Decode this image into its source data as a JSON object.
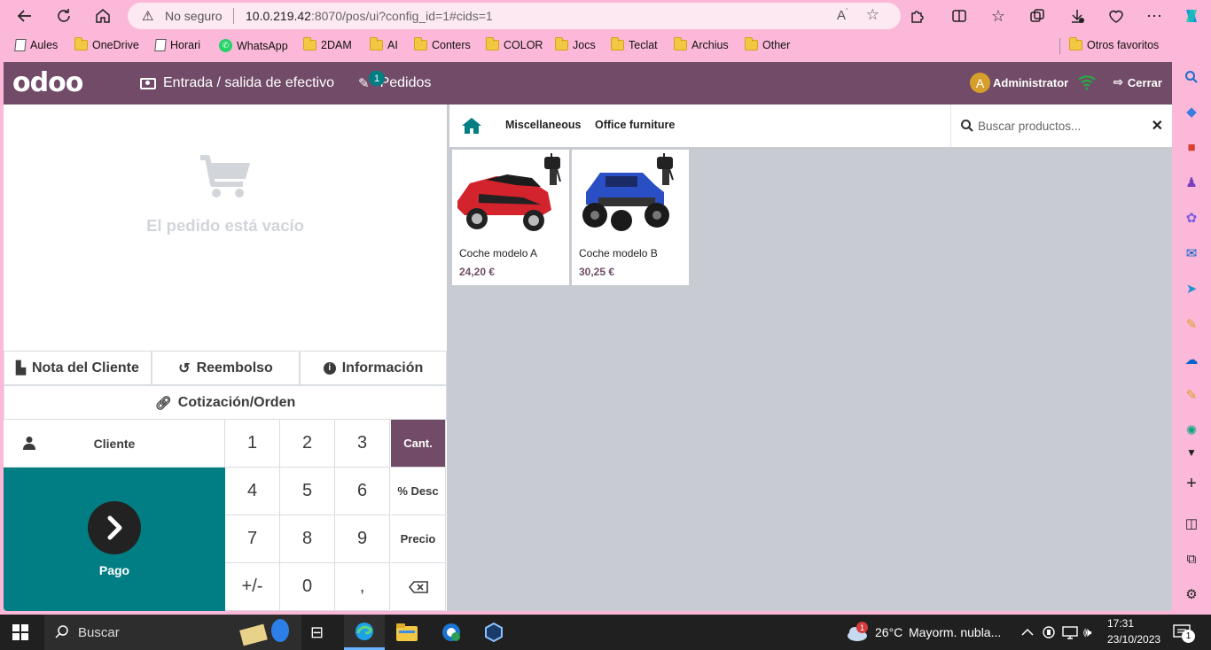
{
  "browser": {
    "insecure_label": "No seguro",
    "url_host": "10.0.219.42",
    "url_rest": ":8070/pos/ui?config_id=1#cids=1"
  },
  "bookmarks": [
    "Aules",
    "OneDrive",
    "Horari",
    "WhatsApp",
    "2DAM",
    "AI",
    "Conters",
    "COLOR",
    "Jocs",
    "Teclat",
    "Archius",
    "Other"
  ],
  "other_favorites": "Otros favoritos",
  "pos": {
    "cash_label": "Entrada / salida de efectivo",
    "orders_label": "Pedidos",
    "orders_count": "1",
    "user_initial": "A",
    "user_name": "Administrator",
    "close_label": "Cerrar",
    "empty_message": "El pedido está vacío",
    "controls": {
      "customer_note": "Nota del Cliente",
      "refund": "Reembolso",
      "info": "Información",
      "quotation": "Cotización/Orden"
    },
    "customer_label": "Cliente",
    "payment_label": "Pago",
    "keypad": [
      "1",
      "2",
      "3",
      "Cant.",
      "4",
      "5",
      "6",
      "% Desc",
      "7",
      "8",
      "9",
      "Precio",
      "+/-",
      "0",
      ","
    ],
    "selected_mode": "Cant.",
    "categories": [
      "Miscellaneous",
      "Office furniture"
    ],
    "search_placeholder": "Buscar productos...",
    "products": [
      {
        "name": "Coche modelo A",
        "price": "24,20 €"
      },
      {
        "name": "Coche modelo B",
        "price": "30,25 €"
      }
    ]
  },
  "taskbar": {
    "search_label": "Buscar",
    "weather_temp": "26°C",
    "weather_text": "Mayorm. nubla...",
    "time": "17:31",
    "date": "23/10/2023",
    "notification_count": "1",
    "weather_badge": "1"
  }
}
